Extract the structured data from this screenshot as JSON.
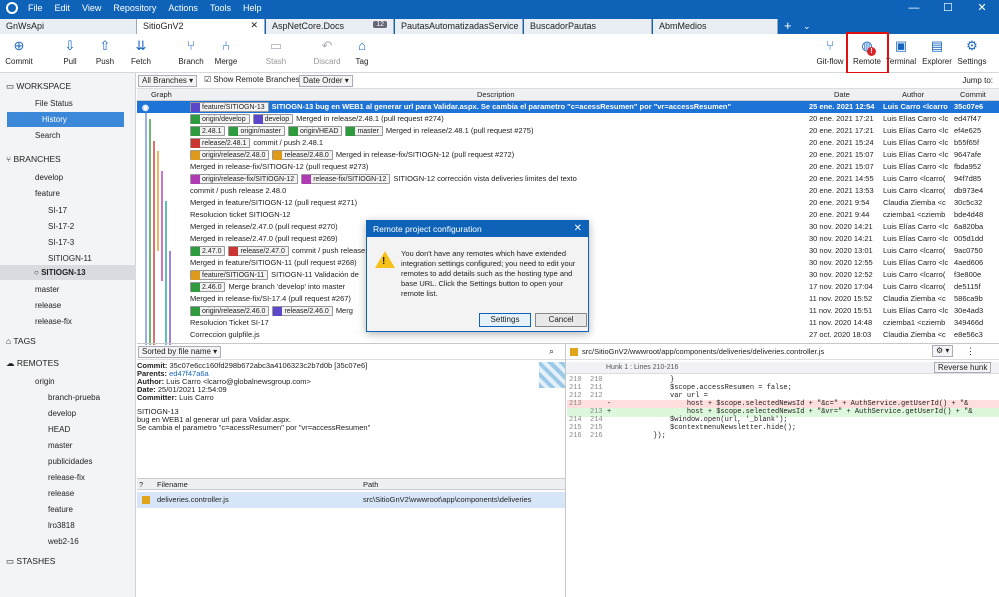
{
  "app": {
    "menu": [
      "File",
      "Edit",
      "View",
      "Repository",
      "Actions",
      "Tools",
      "Help"
    ]
  },
  "tabs": [
    {
      "label": "GnWsApi"
    },
    {
      "label": "SitioGnV2",
      "close": "✕"
    },
    {
      "label": "AspNetCore.Docs",
      "badge": "12"
    },
    {
      "label": "PautasAutomatizadasService"
    },
    {
      "label": "BuscadorPautas"
    },
    {
      "label": "AbmMedios"
    }
  ],
  "toolbar": {
    "commit": "Commit",
    "pull": "Pull",
    "push": "Push",
    "fetch": "Fetch",
    "branch": "Branch",
    "merge": "Merge",
    "stash": "Stash",
    "discard": "Discard",
    "tag": "Tag",
    "gitflow": "Git-flow",
    "remote": "Remote",
    "terminal": "Terminal",
    "explorer": "Explorer",
    "settings": "Settings"
  },
  "sidebar": {
    "workspace": "WORKSPACE",
    "file_status": "File Status",
    "history": "History",
    "search": "Search",
    "branches": "BRANCHES",
    "develop": "develop",
    "feature": "feature",
    "si17": "SI-17",
    "si172": "SI-17-2",
    "si173": "SI-17-3",
    "sitiogn11": "SITIOGN-11",
    "sitiogn13": "SITIOGN-13",
    "master": "master",
    "release": "release",
    "releasefix": "release-fix",
    "tags": "TAGS",
    "remotes": "REMOTES",
    "origin": "origin",
    "remote_items": [
      "branch-prueba",
      "develop",
      "HEAD",
      "master",
      "publicidades",
      "release-fix",
      "release",
      "feature",
      "lro3818",
      "web2-16"
    ],
    "stashes": "STASHES"
  },
  "filters": {
    "all_branches": "All Branches",
    "show_remote": "Show Remote Branches",
    "date_order": "Date Order",
    "jump_to": "Jump to:"
  },
  "columns": {
    "graph": "Graph",
    "description": "Description",
    "date": "Date",
    "author": "Author",
    "commit": "Commit"
  },
  "commits": [
    {
      "refs": [
        [
          "b",
          "feature/SITIOGN-13"
        ]
      ],
      "msg": "SITIOGN-13 bug en WEB1 al generar url para Validar.aspx. Se cambia el parametro \"c=acessResumen\" por \"vr=accessResumen\"",
      "date": "25 ene. 2021 12:54",
      "author": "Luis Carro <lcarro",
      "hash": "35c07e6"
    },
    {
      "refs": [
        [
          "g",
          "origin/develop"
        ],
        [
          "b",
          "develop"
        ]
      ],
      "msg": "Merged in release/2.48.1 (pull request #274)",
      "date": "20 ene. 2021 17:21",
      "author": "Luis Elías Carro <lc",
      "hash": "ed47f47"
    },
    {
      "refs": [
        [
          "g",
          "2.48.1"
        ],
        [
          "g",
          "origin/master"
        ],
        [
          "g",
          "origin/HEAD"
        ],
        [
          "g",
          "master"
        ]
      ],
      "msg": "Merged in release/2.48.1 (pull request #275)",
      "date": "20 ene. 2021 17:21",
      "author": "Luis Elías Carro <lc",
      "hash": "ef4e625"
    },
    {
      "refs": [
        [
          "r",
          "release/2.48.1"
        ]
      ],
      "msg": "commit / push 2.48.1",
      "date": "20 ene. 2021 15:24",
      "author": "Luis Elías Carro <lc",
      "hash": "b55f65f"
    },
    {
      "refs": [
        [
          "o",
          "origin/release/2.48.0"
        ],
        [
          "o",
          "release/2.48.0"
        ]
      ],
      "msg": "Merged in release-fix/SITIOGN-12 (pull request #272)",
      "date": "20 ene. 2021 15:07",
      "author": "Luis Elías Carro <lc",
      "hash": "9647afe"
    },
    {
      "refs": [],
      "msg": "Merged in release-fix/SITIOGN-12 (pull request #273)",
      "date": "20 ene. 2021 15:07",
      "author": "Luis Elías Carro <lc",
      "hash": "fbda952"
    },
    {
      "refs": [
        [
          "p",
          "origin/release-fix/SITIOGN-12"
        ],
        [
          "p",
          "release-fix/SITIOGN-12"
        ]
      ],
      "msg": "SITIOGN-12 corrección vista deliveries limites del texto",
      "date": "20 ene. 2021 14:55",
      "author": "Luis Carro <lcarro(",
      "hash": "94f7d85"
    },
    {
      "refs": [],
      "msg": "commit / push release 2.48.0",
      "date": "20 ene. 2021 13:53",
      "author": "Luis Carro <lcarro(",
      "hash": "db973e4"
    },
    {
      "refs": [],
      "msg": "Merged in feature/SITIOGN-12 (pull request #271)",
      "date": "20 ene. 2021 9:54",
      "author": "Claudia Ziemba <c",
      "hash": "30c5c32"
    },
    {
      "refs": [],
      "msg": "Resolucion ticket SITIOGN-12",
      "date": "20 ene. 2021 9:44",
      "author": "cziemba1 <cziemb",
      "hash": "bde4d48"
    },
    {
      "refs": [],
      "msg": "Merged in release/2.47.0 (pull request #270)",
      "date": "30 nov. 2020 14:21",
      "author": "Luis Elías Carro <lc",
      "hash": "6a820ba"
    },
    {
      "refs": [],
      "msg": "Merged in release/2.47.0 (pull request #269)",
      "date": "30 nov. 2020 14:21",
      "author": "Luis Elías Carro <lc",
      "hash": "005d1dd"
    },
    {
      "refs": [
        [
          "g",
          "2.47.0"
        ],
        [
          "r",
          "release/2.47.0"
        ]
      ],
      "msg": "commit / push release 2.47.0",
      "date": "30 nov. 2020 13:01",
      "author": "Luis Carro <lcarro(",
      "hash": "9ac0750"
    },
    {
      "refs": [],
      "msg": "Merged in feature/SITIOGN-11 (pull request #268)",
      "date": "30 nov. 2020 12:55",
      "author": "Luis Elías Carro <lc",
      "hash": "4aed606"
    },
    {
      "refs": [
        [
          "o",
          "feature/SITIOGN-11"
        ]
      ],
      "msg": "SITIOGN-11 Validación de",
      "date": "30 nov. 2020 12:52",
      "author": "Luis Carro <lcarro(",
      "hash": "f3e800e"
    },
    {
      "refs": [
        [
          "g",
          "2.46.0"
        ]
      ],
      "msg": "Merge branch 'develop' into master",
      "date": "17 nov. 2020 17:04",
      "author": "Luis Carro <lcarro(",
      "hash": "de5115f"
    },
    {
      "refs": [],
      "msg": "Merged in release-fix/SI-17.4 (pull request #267)",
      "date": "11 nov. 2020 15:52",
      "author": "Claudia Ziemba <c",
      "hash": "586ca9b"
    },
    {
      "refs": [
        [
          "g",
          "origin/release/2.46.0"
        ],
        [
          "b",
          "release/2.46.0"
        ]
      ],
      "msg": "Merg",
      "date": "11 nov. 2020 15:51",
      "author": "Luis Elías Carro <lc",
      "hash": "30e4ad3"
    },
    {
      "refs": [],
      "msg": "Resolucion Ticket SI-17",
      "date": "11 nov. 2020 14:48",
      "author": "cziemba1 <cziemb",
      "hash": "349466d"
    },
    {
      "refs": [],
      "msg": "Correccion gulpfile.js",
      "date": "27 oct. 2020 18:03",
      "author": "Claudia Ziemba <c",
      "hash": "e8e56c3"
    }
  ],
  "dialog": {
    "title": "Remote project configuration",
    "body": "You don't have any remotes which have extended integration settings configured; you need to edit your remotes to add details such as the hosting type and base URL. Click the Settings button to open your remote list.",
    "settings": "Settings",
    "cancel": "Cancel"
  },
  "details": {
    "sort": "Sorted by file name",
    "commit_label": "Commit:",
    "commit_val": "35c07e6cc160fd298b672abc3a4106323c2b7d0b [35c07e6]",
    "parents_label": "Parents:",
    "parents_val": "ed47f47a6a",
    "author_label": "Author:",
    "author_val": "Luis Carro <lcarro@globalnewsgroup.com>",
    "date_label": "Date:",
    "date_val": "25/01/2021 12:54:09",
    "committer_label": "Committer:",
    "committer_val": "Luis Carro",
    "message": [
      "SITIOGN-13",
      "bug en WEB1 al generar url para Validar.aspx.",
      "Se cambia el parametro \"c=acessResumen\" por \"vr=accessResumen\""
    ],
    "files_cols": {
      "filename": "Filename",
      "path": "Path"
    },
    "file": {
      "name": "deliveries.controller.js",
      "path": "src\\SitioGnV2\\wwwroot\\app\\components\\deliveries"
    }
  },
  "diff": {
    "file": "src/SitioGnV2/wwwroot/app/components/deliveries/deliveries.controller.js",
    "hunk": "Hunk 1 : Lines 210-216",
    "reverse": "Reverse hunk",
    "lines": [
      {
        "n": "210  210",
        "t": "               }",
        "k": "ctx"
      },
      {
        "n": "211  211",
        "t": "               $scope.accessResumen = false;",
        "k": "ctx"
      },
      {
        "n": "212  212",
        "t": "               var url =",
        "k": "ctx"
      },
      {
        "n": "213",
        "t": "-                  host + $scope.selectedNewsId + \"&c=\" + AuthService.getUserId() + \"&",
        "k": "del"
      },
      {
        "n": "     213",
        "t": "+                  host + $scope.selectedNewsId + \"&vr=\" + AuthService.getUserId() + \"&",
        "k": "add"
      },
      {
        "n": "214  214",
        "t": "               $window.open(url, '_blank');",
        "k": "ctx"
      },
      {
        "n": "215  215",
        "t": "               $contextmenuNewsletter.hide();",
        "k": "ctx"
      },
      {
        "n": "216  216",
        "t": "           });",
        "k": "ctx"
      }
    ]
  }
}
